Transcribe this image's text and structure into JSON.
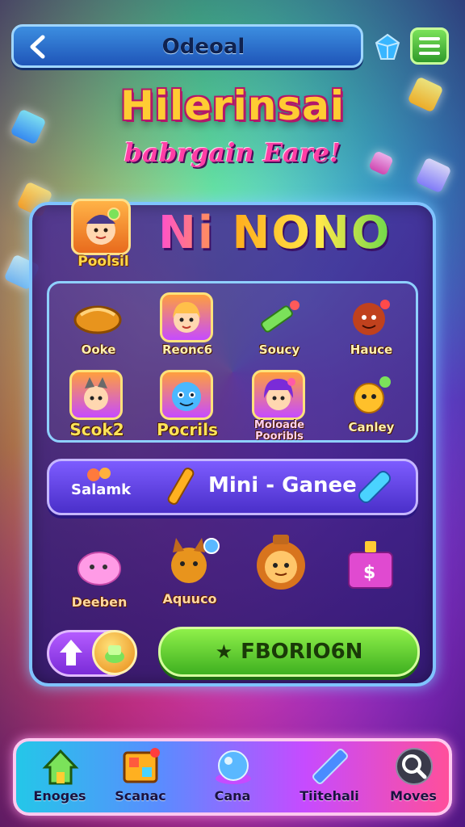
{
  "topbar": {
    "title": "Odeoal",
    "back_icon": "chevron-left-icon",
    "gem_icon": "crystal-icon",
    "menu_icon": "hamburger-menu-icon"
  },
  "headline": "Hilerinsai",
  "subline": "babrgain Eare!",
  "profile": {
    "label": "Poolsil",
    "avatar_icon": "character-avatar-icon"
  },
  "game_logo": "Ni NONO",
  "grid_items": [
    {
      "label": "Ooke",
      "icon": "bread-icon"
    },
    {
      "label": "Reonc6",
      "icon": "girl-character-icon"
    },
    {
      "label": "Soucy",
      "icon": "crayon-icon"
    },
    {
      "label": "Hauce",
      "icon": "creature-icon"
    },
    {
      "label": "Scok2",
      "icon": "cat-character-icon"
    },
    {
      "label": "Pocrils",
      "icon": "blue-creature-icon"
    },
    {
      "label": "Moloade Pooribls",
      "icon": "purple-girl-icon"
    },
    {
      "label": "Canley",
      "icon": "yellow-creature-icon"
    }
  ],
  "minibar": {
    "left_label": "Salamk",
    "title": "Mini - Ganee"
  },
  "lower_items": [
    {
      "label": "Deeben",
      "icon": "pink-blob-icon"
    },
    {
      "label": "Aquuco",
      "icon": "dog-character-icon"
    },
    {
      "label": "",
      "icon": "lion-icon"
    },
    {
      "label": "",
      "icon": "gift-box-icon"
    }
  ],
  "actions": {
    "play_label": "FBORIO6N",
    "up_icon": "arrow-up-icon",
    "coin_icon": "coin-icon"
  },
  "bottom_nav": [
    {
      "label": "Enoges",
      "icon": "home-icon"
    },
    {
      "label": "Scanac",
      "icon": "puzzle-icon"
    },
    {
      "label": "Cana",
      "icon": "orb-icon"
    },
    {
      "label": "Tiitehali",
      "icon": "crystal-icon"
    },
    {
      "label": "Moves",
      "icon": "search-icon"
    }
  ],
  "colors": {
    "accent_orange": "#ffcc33",
    "accent_pink": "#ff3ea5",
    "panel_border": "#7fc3ff",
    "play_green": "#3fb020"
  }
}
